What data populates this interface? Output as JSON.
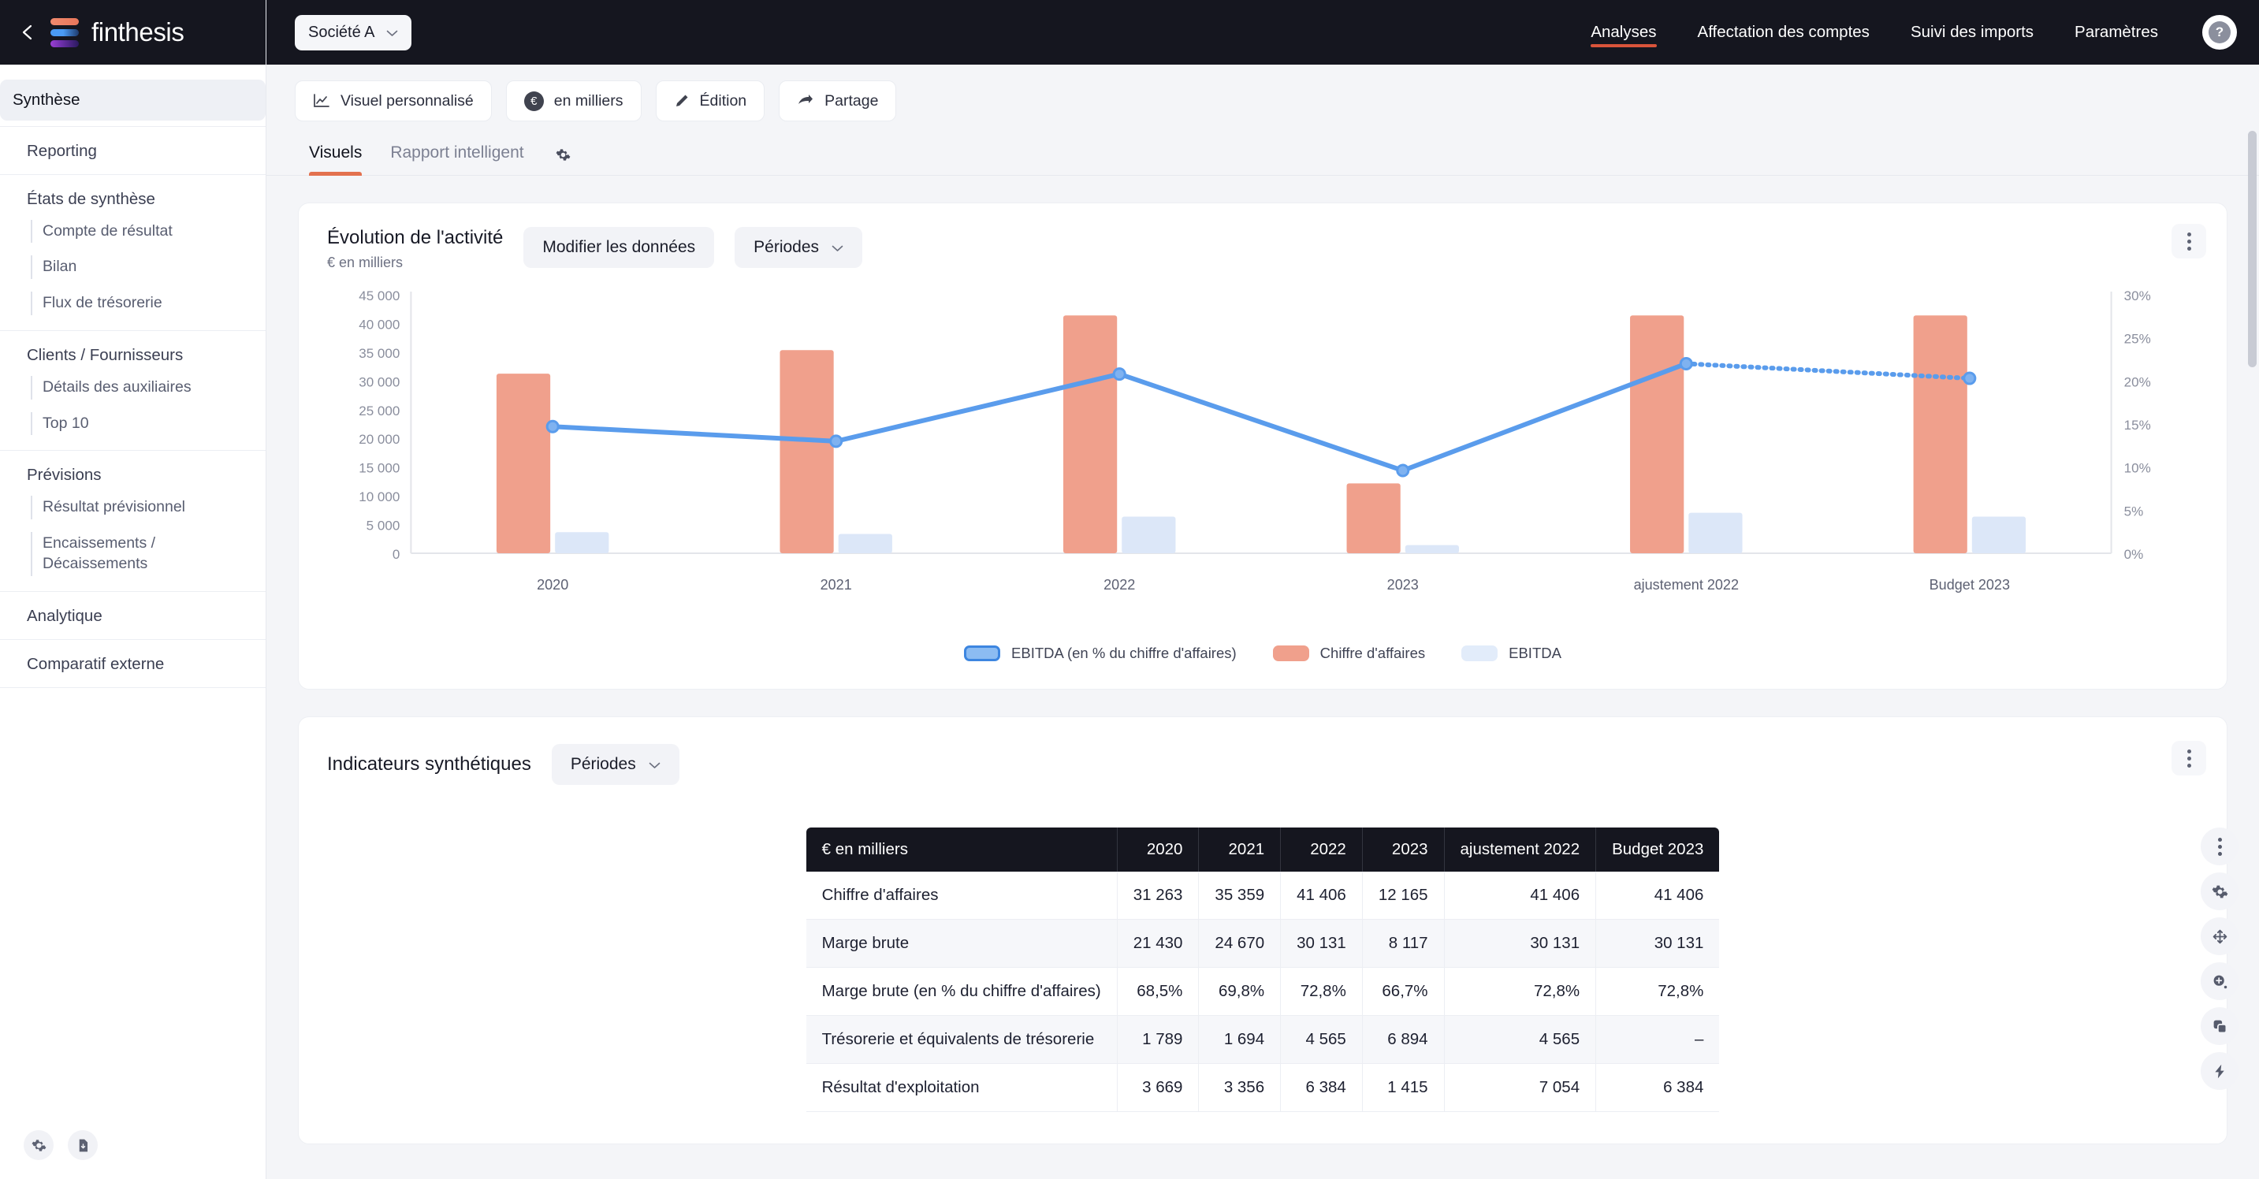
{
  "brand": {
    "name": "finthesis",
    "accent": "#d9543b",
    "logo_bar_colors": [
      "#e8765a",
      "#4a9bf5",
      "#9b3fd4"
    ]
  },
  "topbar": {
    "back_icon": "chevron-left-icon",
    "company_selector": {
      "label": "Société A",
      "icon": "chevron-down-icon"
    },
    "nav": [
      {
        "label": "Analyses",
        "active": true
      },
      {
        "label": "Affectation des comptes",
        "active": false
      },
      {
        "label": "Suivi des imports",
        "active": false
      },
      {
        "label": "Paramètres",
        "active": false
      }
    ],
    "help_label": "?"
  },
  "sidebar": {
    "top_item": {
      "label": "Synthèse",
      "active": true
    },
    "reporting": {
      "label": "Reporting"
    },
    "groups": [
      {
        "label": "États de synthèse",
        "items": [
          "Compte de résultat",
          "Bilan",
          "Flux de trésorerie"
        ]
      },
      {
        "label": "Clients / Fournisseurs",
        "items": [
          "Détails des auxiliaires",
          "Top 10"
        ]
      },
      {
        "label": "Prévisions",
        "items": [
          "Résultat prévisionnel",
          "Encaissements / Décaissements"
        ]
      }
    ],
    "analytique": {
      "label": "Analytique"
    },
    "comparatif": {
      "label": "Comparatif externe"
    },
    "footer_icons": [
      "gear-icon",
      "file-download-icon"
    ]
  },
  "toolbar": [
    {
      "label": "Visuel personnalisé",
      "icon": "line-chart-icon"
    },
    {
      "label": "en milliers",
      "icon": "euro-circle-icon"
    },
    {
      "label": "Édition",
      "icon": "pencil-icon"
    },
    {
      "label": "Partage",
      "icon": "share-icon"
    }
  ],
  "tabs": [
    {
      "label": "Visuels",
      "active": true
    },
    {
      "label": "Rapport intelligent",
      "active": false
    }
  ],
  "tabs_gear_icon": "gear-icon",
  "chart_card": {
    "title": "Évolution de l'activité",
    "subtitle": "€ en milliers",
    "edit_data_button": "Modifier les données",
    "periods_button": "Périodes",
    "menu_icon": "kebab-menu-icon"
  },
  "table_card": {
    "title": "Indicateurs synthétiques",
    "periods_button": "Périodes",
    "menu_icon": "kebab-menu-icon"
  },
  "rail_icons": [
    "kebab-menu-icon",
    "gear-icon",
    "move-icon",
    "zoom-in-icon",
    "duplicate-icon",
    "lightning-icon"
  ],
  "chart_data": {
    "type": "bar",
    "title": "Évolution de l'activité",
    "subtitle": "€ en milliers",
    "categories": [
      "2020",
      "2021",
      "2022",
      "2023",
      "ajustement 2022",
      "Budget 2023"
    ],
    "series": [
      {
        "name": "Chiffre d'affaires",
        "type": "bar",
        "color": "#f0a08c",
        "axis": "left",
        "values": [
          31263,
          35359,
          41406,
          12165,
          41406,
          41406
        ]
      },
      {
        "name": "EBITDA",
        "type": "bar",
        "color": "#dce7f8",
        "axis": "left",
        "values": [
          3669,
          3356,
          6384,
          1415,
          7054,
          6384
        ]
      },
      {
        "name": "EBITDA (en % du chiffre d'affaires)",
        "type": "line",
        "color": "#5a9cec",
        "axis": "right",
        "values": [
          14.7,
          13.0,
          20.8,
          9.6,
          22.0,
          20.3
        ],
        "dashed_from_index": 4
      }
    ],
    "ylabel": "",
    "xlabel": "",
    "ylim": [
      0,
      45000
    ],
    "y2lim": [
      0,
      30
    ],
    "yticks": [
      "45 000",
      "40 000",
      "35 000",
      "30 000",
      "25 000",
      "20 000",
      "15 000",
      "10 000",
      "5 000",
      "0"
    ],
    "y2ticks": [
      "30%",
      "25%",
      "20%",
      "15%",
      "10%",
      "5%",
      "0%"
    ],
    "grid": false,
    "legend": [
      {
        "label": "EBITDA (en % du chiffre d'affaires)",
        "color": "#8cbcf2",
        "border": "#3d86e0"
      },
      {
        "label": "Chiffre d'affaires",
        "color": "#f0a08c",
        "border": "#f0a08c"
      },
      {
        "label": "EBITDA",
        "color": "#e2ecfa",
        "border": "#e2ecfa"
      }
    ],
    "legend_position": "bottom"
  },
  "table": {
    "columns": [
      "€ en milliers",
      "2020",
      "2021",
      "2022",
      "2023",
      "ajustement 2022",
      "Budget 2023"
    ],
    "rows": [
      {
        "label": "Chiffre d'affaires",
        "values": [
          "31 263",
          "35 359",
          "41 406",
          "12 165",
          "41 406",
          "41 406"
        ]
      },
      {
        "label": "Marge brute",
        "values": [
          "21 430",
          "24 670",
          "30 131",
          "8 117",
          "30 131",
          "30 131"
        ]
      },
      {
        "label": "Marge brute (en % du chiffre d'affaires)",
        "values": [
          "68,5%",
          "69,8%",
          "72,8%",
          "66,7%",
          "72,8%",
          "72,8%"
        ]
      },
      {
        "label": "Trésorerie et équivalents de trésorerie",
        "values": [
          "1 789",
          "1 694",
          "4 565",
          "6 894",
          "4 565",
          "–"
        ]
      },
      {
        "label": "Résultat d'exploitation",
        "values": [
          "3 669",
          "3 356",
          "6 384",
          "1 415",
          "7 054",
          "6 384"
        ]
      }
    ]
  }
}
